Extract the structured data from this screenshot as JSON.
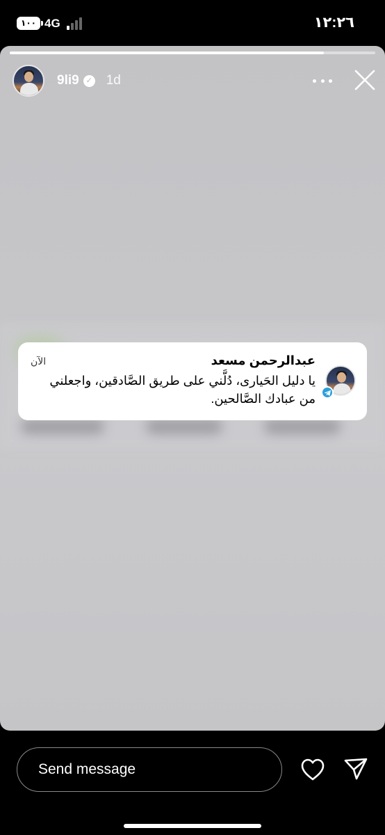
{
  "status_bar": {
    "battery": "١٠٠",
    "network": "4G",
    "time": "١٢:٢٦"
  },
  "story": {
    "progress": 0.86,
    "username": "9li9",
    "time_ago": "1d",
    "icons": {
      "verified": "verified-badge-icon",
      "more": "more-options-icon",
      "close": "close-icon"
    }
  },
  "notification": {
    "sender": "عبدالرحمن مسعد",
    "time": "الآن",
    "text": "يا دليل الحَيارى، دُلَّني على طريق الصَّادقين، واجعلني من عبادك الصَّالحين.",
    "app_icon": "telegram-icon"
  },
  "reply_bar": {
    "placeholder": "Send message",
    "icons": {
      "like": "heart-icon",
      "send": "paper-plane-icon"
    }
  },
  "colors": {
    "background": "#000000",
    "story_bg": "#c6c6c9",
    "notification_bg": "#ffffff",
    "telegram": "#2aa0db"
  }
}
